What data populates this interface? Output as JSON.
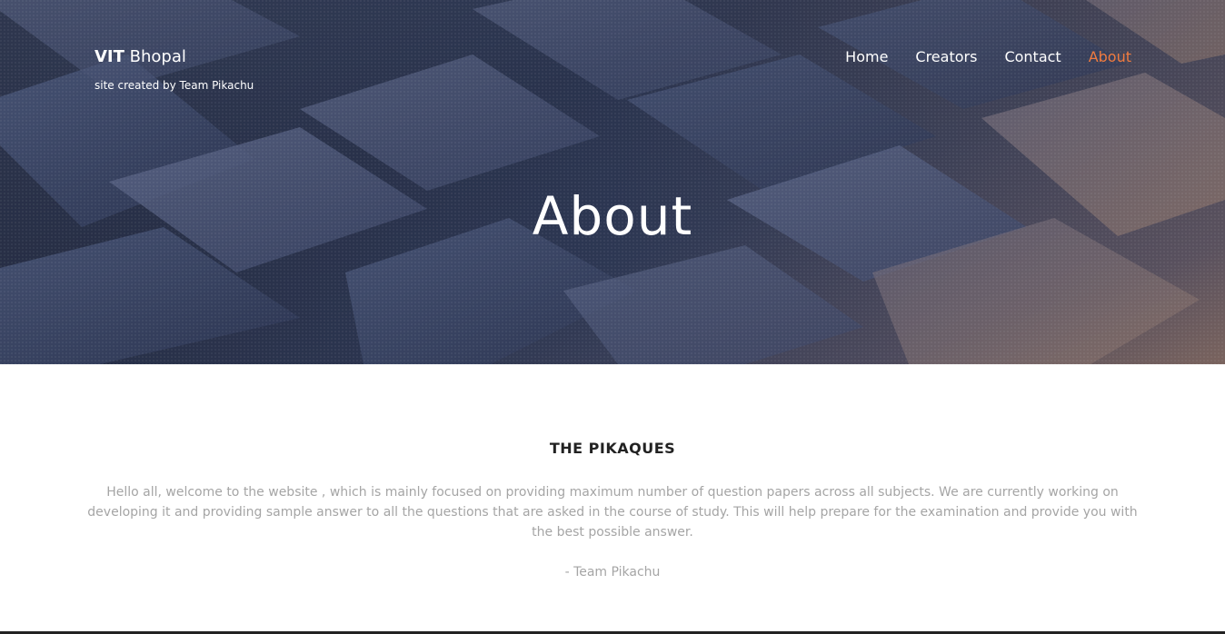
{
  "header": {
    "brand_bold": "VIT",
    "brand_light": "Bhopal",
    "tagline": "site created by Team Pikachu"
  },
  "nav": {
    "items": [
      {
        "label": "Home"
      },
      {
        "label": "Creators"
      },
      {
        "label": "Contact"
      },
      {
        "label": "About"
      }
    ],
    "active": "About",
    "active_color": "#f07b3f"
  },
  "hero": {
    "title": "About"
  },
  "main": {
    "section_title": "THE PIKAQUES",
    "paragraph": "Hello all, welcome to the website , which is mainly focused on providing maximum number of question papers across all subjects. We are currently working on developing it and providing sample answer to all the questions that are asked in the course of study. This will help prepare for the examination and provide you with the best possible answer.",
    "signature": "- Team Pikachu"
  }
}
